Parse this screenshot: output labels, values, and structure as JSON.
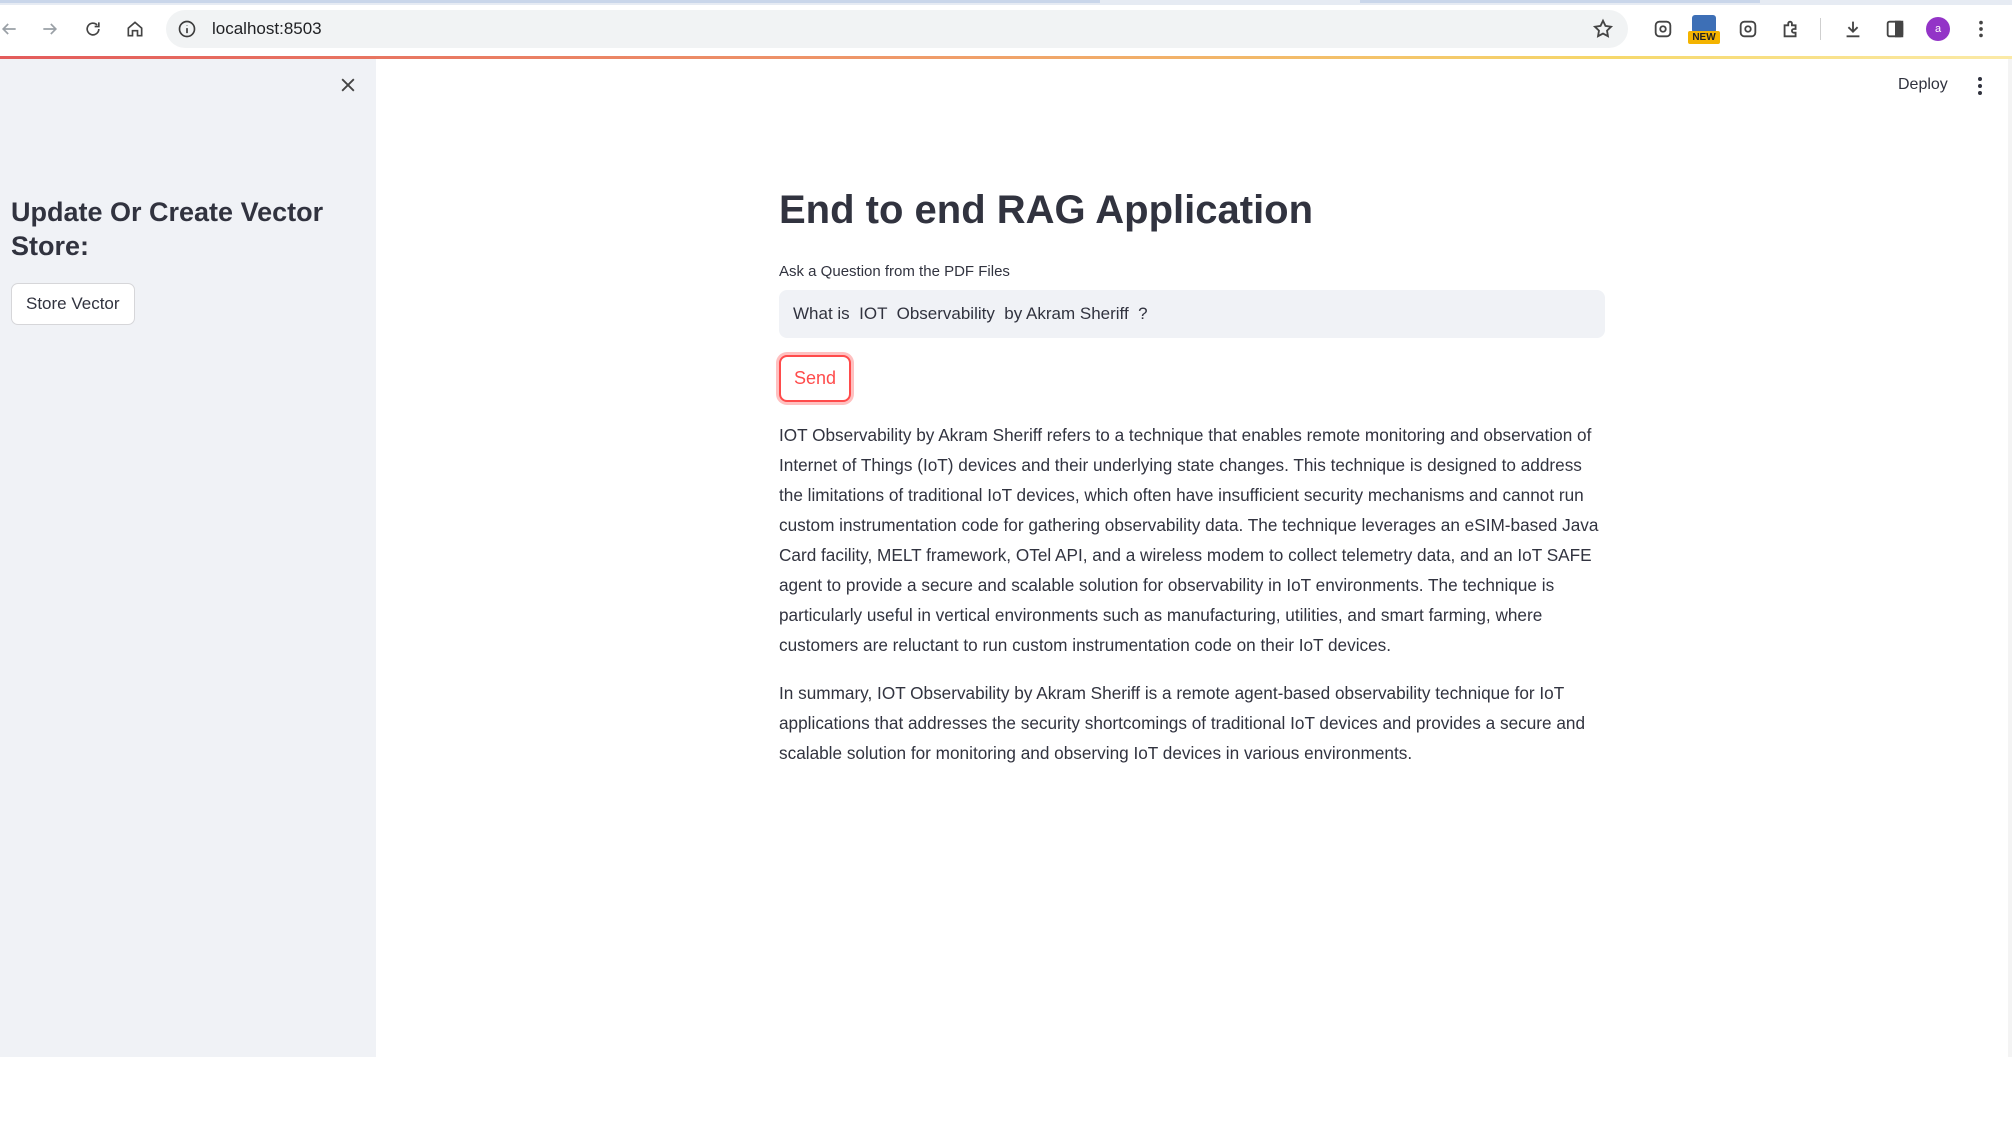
{
  "browser": {
    "url": "localhost:8503",
    "avatar_letter": "a",
    "new_badge": "NEW",
    "accent_gradient": [
      "#e35b5b",
      "#ef9a6a",
      "#f6d86b"
    ]
  },
  "header": {
    "deploy_label": "Deploy"
  },
  "sidebar": {
    "heading": "Update Or Create Vector Store:",
    "store_button_label": "Store Vector",
    "background_color": "#f0f2f6"
  },
  "main": {
    "title": "End to end RAG Application",
    "question_label": "Ask a Question from the PDF Files",
    "question_value": "What is  IOT  Observability  by Akram Sheriff  ?",
    "send_button_label": "Send",
    "send_button_color": "#ff4b4b",
    "answer_paragraphs": [
      "IOT Observability by Akram Sheriff refers to a technique that enables remote monitoring and observation of Internet of Things (IoT) devices and their underlying state changes. This technique is designed to address the limitations of traditional IoT devices, which often have insufficient security mechanisms and cannot run custom instrumentation code for gathering observability data. The technique leverages an eSIM-based Java Card facility, MELT framework, OTel API, and a wireless modem to collect telemetry data, and an IoT SAFE agent to provide a secure and scalable solution for observability in IoT environments. The technique is particularly useful in vertical environments such as manufacturing, utilities, and smart farming, where customers are reluctant to run custom instrumentation code on their IoT devices.",
      "In summary, IOT Observability by Akram Sheriff is a remote agent-based observability technique for IoT applications that addresses the security shortcomings of traditional IoT devices and provides a secure and scalable solution for monitoring and observing IoT devices in various environments."
    ]
  }
}
